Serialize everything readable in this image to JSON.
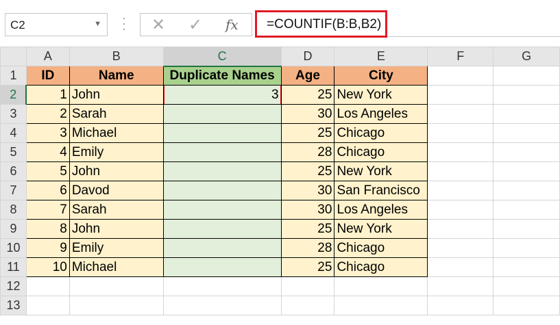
{
  "name_box": {
    "value": "C2"
  },
  "formula_bar": {
    "cancel_icon": "✕",
    "enter_icon": "✓",
    "fx_label": "fx",
    "formula": "=COUNTIF(B:B,B2)"
  },
  "columns": [
    "A",
    "B",
    "C",
    "D",
    "E",
    "F",
    "G"
  ],
  "rows": [
    "1",
    "2",
    "3",
    "4",
    "5",
    "6",
    "7",
    "8",
    "9",
    "10",
    "11",
    "12",
    "13"
  ],
  "table": {
    "headers": {
      "id": "ID",
      "name": "Name",
      "dup": "Duplicate Names",
      "age": "Age",
      "city": "City"
    },
    "records": [
      {
        "id": "1",
        "name": "John",
        "dup": "3",
        "age": "25",
        "city": "New York"
      },
      {
        "id": "2",
        "name": "Sarah",
        "dup": "",
        "age": "30",
        "city": "Los Angeles"
      },
      {
        "id": "3",
        "name": "Michael",
        "dup": "",
        "age": "25",
        "city": "Chicago"
      },
      {
        "id": "4",
        "name": "Emily",
        "dup": "",
        "age": "28",
        "city": "Chicago"
      },
      {
        "id": "5",
        "name": "John",
        "dup": "",
        "age": "25",
        "city": "New York"
      },
      {
        "id": "6",
        "name": "Davod",
        "dup": "",
        "age": "30",
        "city": "San Francisco"
      },
      {
        "id": "7",
        "name": "Sarah",
        "dup": "",
        "age": "30",
        "city": "Los Angeles"
      },
      {
        "id": "8",
        "name": "John",
        "dup": "",
        "age": "25",
        "city": "New York"
      },
      {
        "id": "9",
        "name": "Emily",
        "dup": "",
        "age": "28",
        "city": "Chicago"
      },
      {
        "id": "10",
        "name": "Michael",
        "dup": "",
        "age": "25",
        "city": "Chicago"
      }
    ]
  },
  "colors": {
    "header_orange": "#f4b183",
    "header_green": "#a9d18e",
    "data_cream": "#fff2cc",
    "data_green": "#e2efda",
    "highlight_red": "#e01a24",
    "excel_green": "#217346"
  }
}
